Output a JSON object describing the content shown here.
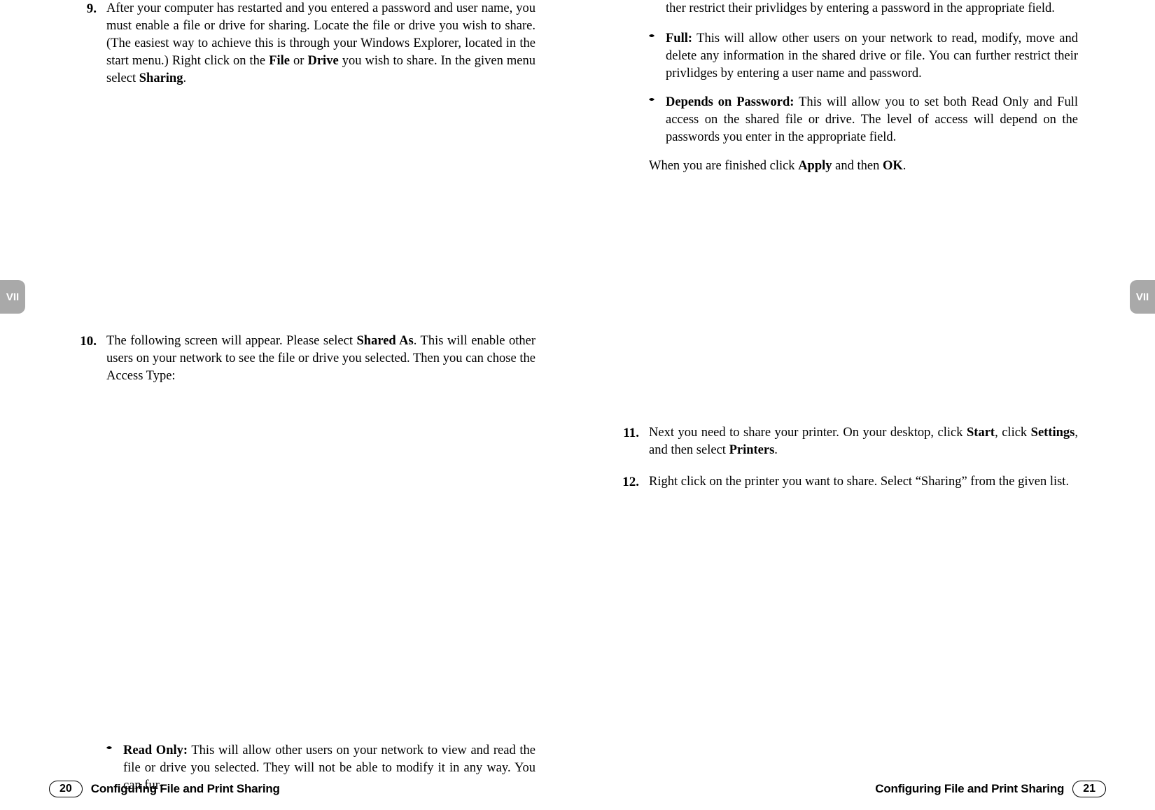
{
  "tabs": {
    "left": "VII",
    "right": "VII"
  },
  "leftPage": {
    "step9": {
      "num": "9.",
      "pre": "After your computer has restarted and you entered a password and user name, you must enable a file or drive for sharing. Locate the file or drive you wish to share. (The easiest way to achieve this is through your Windows Explorer, located in the start menu.) Right click on the ",
      "b1": "File",
      "mid1": " or ",
      "b2": "Drive",
      "mid2": " you wish to share. In the given menu select ",
      "b3": "Sharing",
      "post": "."
    },
    "step10": {
      "num": "10.",
      "pre": "The following screen will appear. Please select ",
      "b1": "Shared As",
      "post": ". This will enable other users on your network to see the file or drive you selected. Then  you can chose the Access Type:"
    },
    "readOnly": {
      "label": "Read Only:",
      "text": " This will allow other users on your network to view and read the file or drive you selected. They will not be able to modify it in any way. You can fur-"
    },
    "footer": {
      "num": "20",
      "title": "Configuring File and Print Sharing"
    }
  },
  "rightPage": {
    "cont": "ther restrict their privlidges by entering a password in the appropriate field.",
    "full": {
      "label": "Full:",
      "text": " This will allow other users on your network to read, modify, move and delete any information in the shared drive or file. You can further restrict their privlidges by entering a user name and password."
    },
    "depends": {
      "label": "Depends on Password:",
      "text": " This will allow you to set both Read Only and Full access on the shared file or drive. The level of access will depend on the passwords you enter in the appropriate field."
    },
    "closing": {
      "pre": "When you are finished click ",
      "b1": "Apply",
      "mid": " and then ",
      "b2": "OK",
      "post": "."
    },
    "step11": {
      "num": "11.",
      "pre": "Next you need to share your printer. On your desktop, click ",
      "b1": "Start",
      "mid1": ", click ",
      "b2": "Settings",
      "mid2": ", and then select ",
      "b3": "Printers",
      "post": "."
    },
    "step12": {
      "num": "12.",
      "text": "Right click on the printer you want to share. Select “Sharing” from the given list."
    },
    "footer": {
      "num": "21",
      "title": "Configuring File and Print Sharing"
    }
  }
}
